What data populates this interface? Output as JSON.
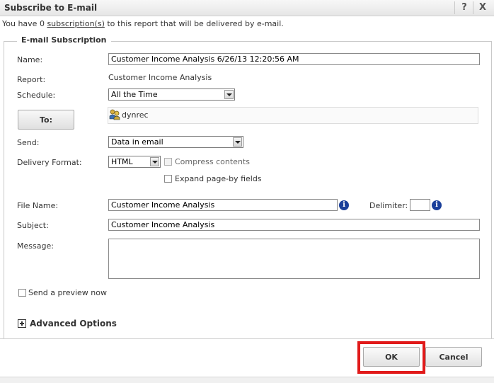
{
  "dialog": {
    "title": "Subscribe to E-mail",
    "help_label": "?",
    "close_label": "X"
  },
  "info": {
    "prefix": "You have 0 ",
    "link": "subscription(s)",
    "suffix": " to this report that will be delivered by e-mail."
  },
  "section": {
    "legend": "E-mail Subscription"
  },
  "form": {
    "name_label": "Name:",
    "name_value": "Customer Income Analysis 6/26/13 12:20:56 AM",
    "report_label": "Report:",
    "report_value": "Customer Income Analysis",
    "schedule_label": "Schedule:",
    "schedule_value": "All the Time",
    "to_button": "To:",
    "recipient": "dynrec",
    "send_label": "Send:",
    "send_value": "Data in email",
    "format_label": "Delivery Format:",
    "format_value": "HTML",
    "compress_label": "Compress contents",
    "expand_label": "Expand page-by fields",
    "filename_label": "File Name:",
    "filename_value": "Customer Income Analysis",
    "delimiter_label": "Delimiter:",
    "delimiter_value": "",
    "subject_label": "Subject:",
    "subject_value": "Customer Income Analysis",
    "message_label": "Message:",
    "message_value": "",
    "preview_label": "Send a preview now",
    "advanced_label": "Advanced Options"
  },
  "footer": {
    "ok_label": "OK",
    "cancel_label": "Cancel"
  },
  "colors": {
    "highlight": "#e11a1a",
    "info_icon": "#1a3f9a"
  }
}
